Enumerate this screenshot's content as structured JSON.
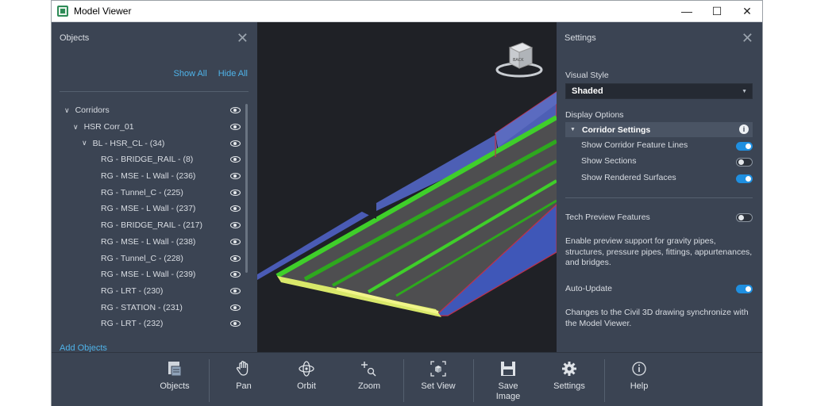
{
  "window": {
    "title": "Model Viewer"
  },
  "objects_panel": {
    "title": "Objects",
    "show_all": "Show All",
    "hide_all": "Hide All",
    "add_objects": "Add Objects",
    "tree": [
      {
        "label": "Corridors",
        "level": 0,
        "expanded": true
      },
      {
        "label": "HSR Corr_01",
        "level": 1,
        "expanded": true
      },
      {
        "label": "BL - HSR_CL - (34)",
        "level": 2,
        "expanded": true
      },
      {
        "label": "RG - BRIDGE_RAIL - (8)",
        "level": 3
      },
      {
        "label": "RG - MSE - L Wall - (236)",
        "level": 3
      },
      {
        "label": "RG - Tunnel_C - (225)",
        "level": 3
      },
      {
        "label": "RG - MSE - L Wall - (237)",
        "level": 3
      },
      {
        "label": "RG - BRIDGE_RAIL - (217)",
        "level": 3
      },
      {
        "label": "RG - MSE - L Wall - (238)",
        "level": 3
      },
      {
        "label": "RG - Tunnel_C - (228)",
        "level": 3
      },
      {
        "label": "RG - MSE - L Wall - (239)",
        "level": 3
      },
      {
        "label": "RG - LRT - (230)",
        "level": 3
      },
      {
        "label": "RG - STATION - (231)",
        "level": 3
      },
      {
        "label": "RG - LRT - (232)",
        "level": 3
      }
    ]
  },
  "viewcube": {
    "face_label": "BACK"
  },
  "settings_panel": {
    "title": "Settings",
    "visual_style_label": "Visual Style",
    "visual_style_value": "Shaded",
    "display_options_label": "Display Options",
    "corridor_settings_label": "Corridor Settings",
    "toggles": [
      {
        "label": "Show Corridor Feature Lines",
        "on": true
      },
      {
        "label": "Show Sections",
        "on": false
      },
      {
        "label": "Show Rendered Surfaces",
        "on": true
      }
    ],
    "tech_preview_label": "Tech Preview Features",
    "tech_preview_on": false,
    "tech_preview_desc": "Enable preview support for gravity pipes, structures, pressure pipes, fittings, appurtenances, and bridges.",
    "auto_update_label": "Auto-Update",
    "auto_update_on": true,
    "auto_update_desc": "Changes to the Civil 3D drawing synchronize with the Model Viewer."
  },
  "toolbar": {
    "objects": "Objects",
    "pan": "Pan",
    "orbit": "Orbit",
    "zoom": "Zoom",
    "set_view": "Set View",
    "save_image": "Save Image",
    "settings": "Settings",
    "help": "Help"
  },
  "colors": {
    "accent": "#4fb3e9",
    "toggle_on": "#1f8fe0",
    "panel_bg": "#3b4453"
  }
}
